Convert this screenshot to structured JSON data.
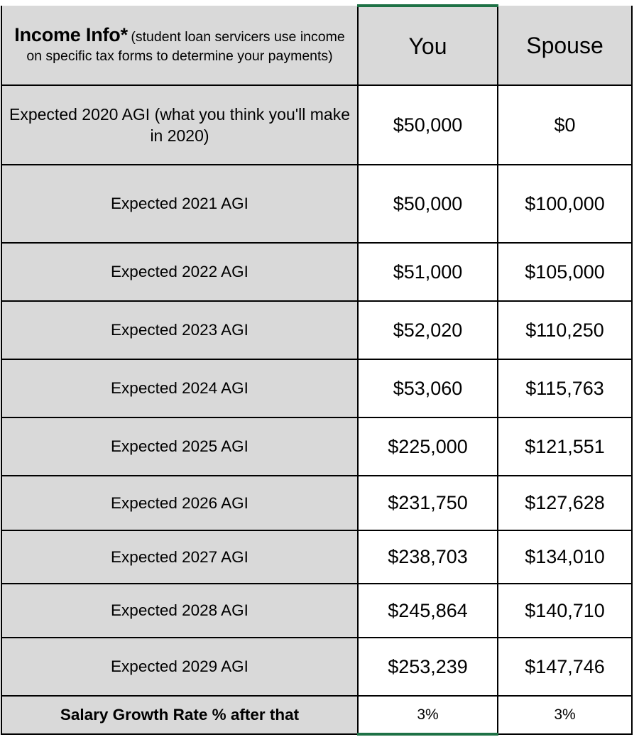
{
  "table": {
    "title": {
      "strong": "Income Info*",
      "note": "(student loan servicers use income on specific tax forms to determine your payments)"
    },
    "columns": [
      {
        "key": "label",
        "label": ""
      },
      {
        "key": "you",
        "label": "You"
      },
      {
        "key": "spouse",
        "label": "Spouse"
      }
    ],
    "rows": [
      {
        "label": "Expected 2020 AGI (what you think you'll make in 2020)",
        "you": "$50,000",
        "spouse": "$0"
      },
      {
        "label": "Expected 2021 AGI",
        "you": "$50,000",
        "spouse": "$100,000"
      },
      {
        "label": "Expected 2022 AGI",
        "you": "$51,000",
        "spouse": "$105,000"
      },
      {
        "label": "Expected 2023 AGI",
        "you": "$52,020",
        "spouse": "$110,250"
      },
      {
        "label": "Expected 2024 AGI",
        "you": "$53,060",
        "spouse": "$115,763"
      },
      {
        "label": "Expected 2025 AGI",
        "you": "$225,000",
        "spouse": "$121,551"
      },
      {
        "label": "Expected 2026 AGI",
        "you": "$231,750",
        "spouse": "$127,628"
      },
      {
        "label": "Expected 2027 AGI",
        "you": "$238,703",
        "spouse": "$134,010"
      },
      {
        "label": "Expected 2028 AGI",
        "you": "$245,864",
        "spouse": "$140,710"
      },
      {
        "label": "Expected 2029 AGI",
        "you": "$253,239",
        "spouse": "$147,746"
      }
    ],
    "footer_row": {
      "label": "Salary Growth Rate % after that",
      "you": "3%",
      "spouse": "3%"
    }
  },
  "colors": {
    "header_fill": "#D9D9D9",
    "label_fill": "#D9D9D9",
    "value_fill": "#FFFFFF",
    "grid": "#000000",
    "accent_green": "#1E7145",
    "text": "#000000"
  }
}
